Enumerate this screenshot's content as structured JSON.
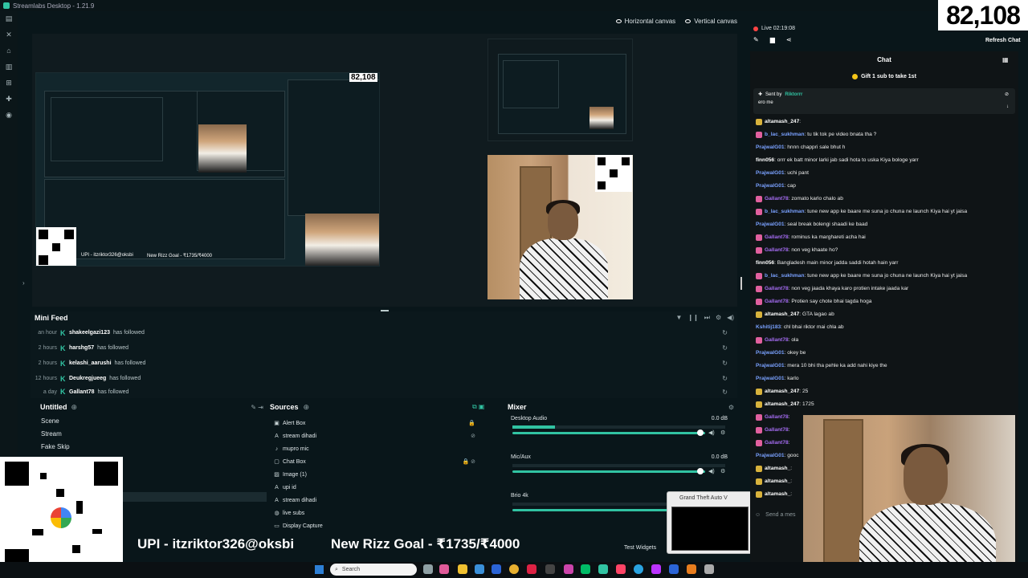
{
  "window": {
    "title": "Streamlabs Desktop - 1.21.9"
  },
  "viewer_count": "82,108",
  "canvas_tabs": {
    "horizontal": "Horizontal canvas",
    "vertical": "Vertical canvas"
  },
  "preview": {
    "nested_count": "82,108",
    "nested_upi": "UPI - itzriktor326@oksbi",
    "nested_goal": "New Rizz Goal - ₹1735/₹4000"
  },
  "minifeed": {
    "title": "Mini Feed",
    "rows": [
      {
        "time": "an hour",
        "user": "shakeelgazi123",
        "action": "has followed"
      },
      {
        "time": "2 hours",
        "user": "harshg57",
        "action": "has followed"
      },
      {
        "time": "2 hours",
        "user": "kelashi_aarushi",
        "action": "has followed"
      },
      {
        "time": "12 hours",
        "user": "Deukregjueeg",
        "action": "has followed"
      },
      {
        "time": "a day",
        "user": "Gallant78",
        "action": "has followed"
      }
    ]
  },
  "scenes": {
    "title": "Untitled",
    "items": [
      "Scene",
      "Stream",
      "Fake Skip"
    ]
  },
  "sources": {
    "title": "Sources",
    "items": [
      "Alert Box",
      "stream dihadi",
      "mupro mic",
      "Chat Box",
      "Image (1)",
      "upi id",
      "stream dihadi",
      "live subs",
      "Display Capture"
    ]
  },
  "mixer": {
    "title": "Mixer",
    "channels": [
      {
        "name": "Desktop Audio",
        "db": "0.0 dB",
        "level": 0.2
      },
      {
        "name": "Mic/Aux",
        "db": "0.0 dB",
        "level": 0.0
      },
      {
        "name": "Brio 4k",
        "db": "",
        "level": 0.0
      }
    ]
  },
  "test_widgets": "Test Widgets",
  "gta_window": {
    "title": "Grand Theft Auto V"
  },
  "live": {
    "label": "Live 02:19:08"
  },
  "refresh_chat": "Refresh Chat",
  "chat": {
    "title": "Chat",
    "gift": "Gift 1 sub to take 1st",
    "pinned": {
      "sent_by": "Sent by",
      "sender": "Riktorrr",
      "text": "ero me"
    },
    "send_placeholder": "Send a mes",
    "messages": [
      {
        "user": "altamash_247",
        "text": "",
        "color": "white",
        "badge": "gold"
      },
      {
        "user": "b_lac_sukhman",
        "text": "tu tik tok pe video bnata tha ?",
        "color": "blue",
        "badge": "pink"
      },
      {
        "user": "PrajwalG01",
        "text": "hnnn chappri sale bhut h",
        "color": "blue",
        "badge": ""
      },
      {
        "user": "finn056",
        "text": "orrr ek batt minor larki jab sadi hota to uska Kiya bologe yarr",
        "color": "white",
        "badge": ""
      },
      {
        "user": "PrajwalG01",
        "text": "uchi pant",
        "color": "blue",
        "badge": ""
      },
      {
        "user": "PrajwalG01",
        "text": "cap",
        "color": "blue",
        "badge": ""
      },
      {
        "user": "Gallant78",
        "text": "zomato karlo chalo ab",
        "color": "purple",
        "badge": "pink"
      },
      {
        "user": "b_lac_sukhman",
        "text": "tune new app ke baare me suna jo chuna ne launch Kiya hai yt jaisa",
        "color": "blue",
        "badge": "pink"
      },
      {
        "user": "PrajwalG01",
        "text": "seal break bolengi shaadi ke baad",
        "color": "blue",
        "badge": ""
      },
      {
        "user": "Gallant78",
        "text": "rominus ka marghareti acha hai",
        "color": "purple",
        "badge": "pink"
      },
      {
        "user": "Gallant78",
        "text": "non veg khaate ho?",
        "color": "purple",
        "badge": "pink"
      },
      {
        "user": "finn056",
        "text": "Bangladesh main minor jadda saddi hotah hain yarr",
        "color": "white",
        "badge": ""
      },
      {
        "user": "b_lac_sukhman",
        "text": "tune new app ke baare me suna jo chuna ne launch Kiya hai yt jaisa",
        "color": "blue",
        "badge": "pink"
      },
      {
        "user": "Gallant78",
        "text": "non veg jaada khaya karo protien intake jaada kar",
        "color": "purple",
        "badge": "pink"
      },
      {
        "user": "Gallant78",
        "text": "Protien say chote bhai tagda hoga",
        "color": "purple",
        "badge": "pink"
      },
      {
        "user": "altamash_247",
        "text": "GTA lagao ab",
        "color": "white",
        "badge": "gold"
      },
      {
        "user": "Kshitij183",
        "text": "chl bhai riktor mai chla ab",
        "color": "blue",
        "badge": ""
      },
      {
        "user": "Gallant78",
        "text": "ola",
        "color": "purple",
        "badge": "pink"
      },
      {
        "user": "PrajwalG01",
        "text": "okey be",
        "color": "blue",
        "badge": ""
      },
      {
        "user": "PrajwalG01",
        "text": "mera 10 bhi tha pehle ka add nahi kiye the",
        "color": "blue",
        "badge": ""
      },
      {
        "user": "PrajwalG01",
        "text": "karlo",
        "color": "blue",
        "badge": ""
      },
      {
        "user": "altamash_247",
        "text": "25",
        "color": "white",
        "badge": "gold"
      },
      {
        "user": "altamash_247",
        "text": "1725",
        "color": "white",
        "badge": "gold"
      },
      {
        "user": "Gallant78",
        "text": "",
        "color": "purple",
        "badge": "pink"
      },
      {
        "user": "Gallant78",
        "text": "",
        "color": "purple",
        "badge": "pink"
      },
      {
        "user": "Gallant78",
        "text": "",
        "color": "purple",
        "badge": "pink"
      },
      {
        "user": "PrajwalG01",
        "text": "gooc",
        "color": "blue",
        "badge": ""
      },
      {
        "user": "altamash_",
        "text": "",
        "color": "white",
        "badge": "gold"
      },
      {
        "user": "altamash_",
        "text": "",
        "color": "white",
        "badge": "gold"
      },
      {
        "user": "altamash_",
        "text": "",
        "color": "white",
        "badge": "gold"
      }
    ]
  },
  "overlay": {
    "upi": "UPI - itzriktor326@oksbi",
    "goal": "New Rizz Goal - ₹1735/₹4000"
  },
  "taskbar": {
    "search": "Search"
  },
  "colors": {
    "accent": "#31c3a2",
    "bg": "#09161a",
    "chat_bg": "#0f1416"
  }
}
